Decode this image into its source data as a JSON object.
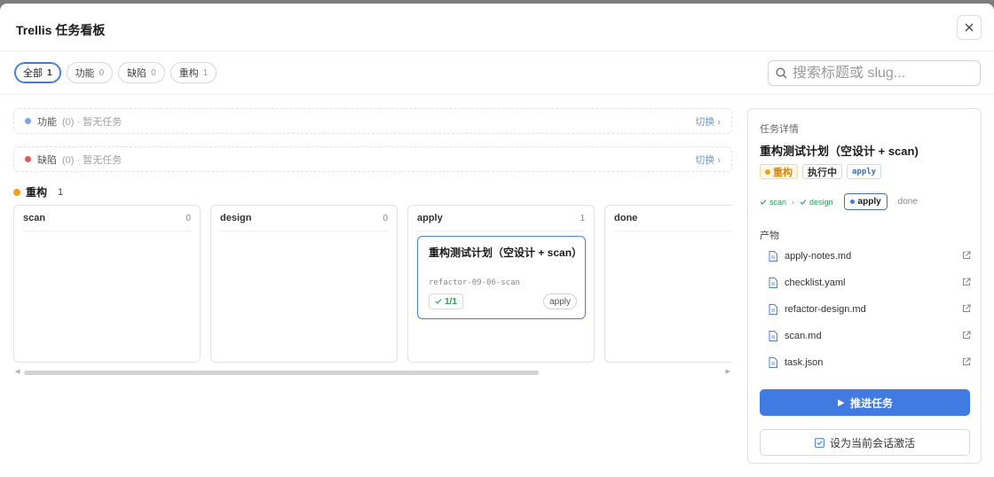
{
  "window": {
    "title": "Trellis 任务看板"
  },
  "filters": [
    {
      "label": "全部",
      "count": "1",
      "active": true
    },
    {
      "label": "功能",
      "count": "0",
      "active": false
    },
    {
      "label": "缺陷",
      "count": "0",
      "active": false
    },
    {
      "label": "重构",
      "count": "1",
      "active": false
    }
  ],
  "search": {
    "placeholder": "搜索标题或 slug..."
  },
  "lanes": {
    "feature": {
      "name": "功能",
      "meta": "(0) · 暂无任务",
      "switch": "切换 ›",
      "color": "#7ea3e6"
    },
    "bug": {
      "name": "缺陷",
      "meta": "(0) · 暂无任务",
      "switch": "切换 ›",
      "color": "#e25a5a"
    },
    "refactor": {
      "name": "重构",
      "count": "1",
      "color": "#f0a020"
    }
  },
  "columns": [
    {
      "name": "scan",
      "count": "0"
    },
    {
      "name": "design",
      "count": "0"
    },
    {
      "name": "apply",
      "count": "1"
    },
    {
      "name": "done",
      "count": ""
    }
  ],
  "card": {
    "title": "重构测试计划（空设计 + scan）",
    "slug": "refactor-09-06-scan",
    "progress": "1/1",
    "stage": "apply"
  },
  "detail": {
    "section_label": "任务详情",
    "title": "重构测试计划（空设计 + scan)",
    "tags": {
      "type": "重构",
      "status": "执行中",
      "stage": "apply"
    },
    "pipeline": {
      "done": [
        "scan",
        "design"
      ],
      "current": "apply",
      "pending": "done"
    },
    "artifacts_label": "产物",
    "artifacts": [
      "apply-notes.md",
      "checklist.yaml",
      "refactor-design.md",
      "scan.md",
      "task.json"
    ],
    "primary_button": "推进任务",
    "secondary_button": "设为当前会话激活"
  },
  "colors": {
    "accent": "#3f7be0",
    "done": "#2aa15c",
    "refactor": "#f0a020"
  }
}
